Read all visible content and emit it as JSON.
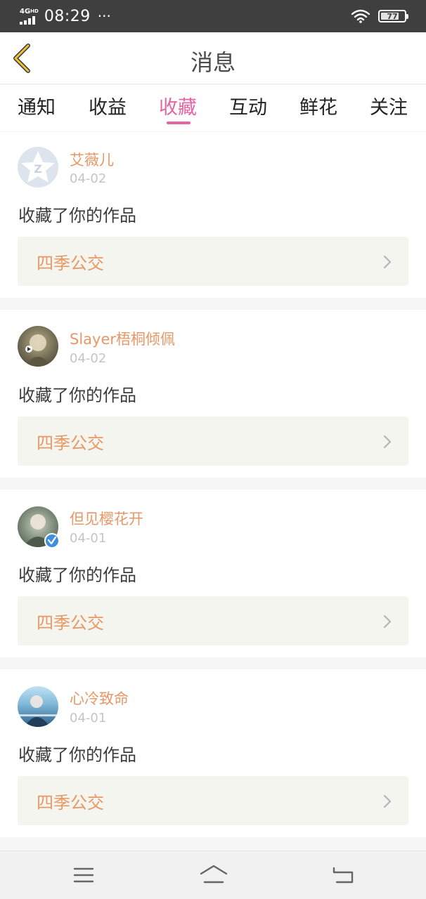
{
  "status_bar": {
    "network": "4G",
    "network_sup": "HD",
    "time": "08:29",
    "more": "···",
    "battery": "77",
    "battery_level": 0.77,
    "icons": [
      "signal-icon",
      "wifi-icon",
      "battery-icon"
    ]
  },
  "header": {
    "title": "消息",
    "back_icon": "chevron-left-icon"
  },
  "tabs": [
    {
      "label": "通知",
      "active": false
    },
    {
      "label": "收益",
      "active": false
    },
    {
      "label": "收藏",
      "active": true
    },
    {
      "label": "互动",
      "active": false
    },
    {
      "label": "鲜花",
      "active": false
    },
    {
      "label": "关注",
      "active": false
    }
  ],
  "messages": [
    {
      "name": "艾薇儿",
      "date": "04-02",
      "action": "收藏了你的作品",
      "work": "四季公交",
      "avatar": "default-star-avatar"
    },
    {
      "name": "Slayer梧桐倾佩",
      "date": "04-02",
      "action": "收藏了你的作品",
      "work": "四季公交",
      "avatar": "user-photo-avatar"
    },
    {
      "name": "但见樱花开",
      "date": "04-01",
      "action": "收藏了你的作品",
      "work": "四季公交",
      "avatar": "user-photo-avatar",
      "verified": true
    },
    {
      "name": "心冷致命",
      "date": "04-01",
      "action": "收藏了你的作品",
      "work": "四季公交",
      "avatar": "user-photo-avatar"
    }
  ],
  "nav_bar": {
    "icons": [
      "menu-icon",
      "home-icon",
      "back-icon"
    ]
  },
  "colors": {
    "accent": "#e764a3",
    "name": "#e89766",
    "back_arrow": "#e8b02a",
    "status_bar": "#3f3f3f"
  }
}
